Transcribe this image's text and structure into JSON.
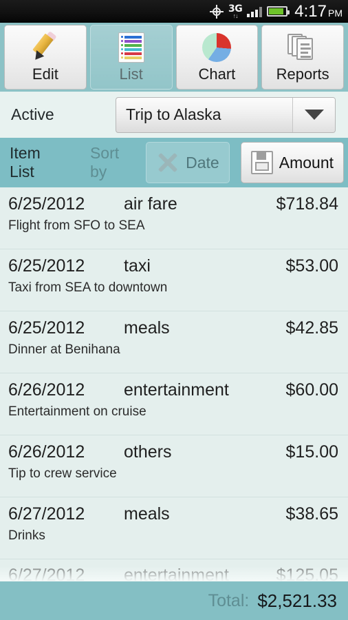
{
  "statusbar": {
    "gps_icon": "gps-crosshair-icon",
    "network_label": "3G",
    "network_arrows": "↑↓",
    "signal_icon": "signal-bars-icon",
    "battery_icon": "battery-icon",
    "time": "4:17",
    "ampm": "PM"
  },
  "toolbar": {
    "buttons": [
      {
        "label": "Edit",
        "icon": "pencil-icon",
        "selected": false
      },
      {
        "label": "List",
        "icon": "list-icon",
        "selected": true
      },
      {
        "label": "Chart",
        "icon": "pie-chart-icon",
        "selected": false
      },
      {
        "label": "Reports",
        "icon": "documents-icon",
        "selected": false
      }
    ]
  },
  "active": {
    "label": "Active",
    "selected_trip": "Trip to Alaska",
    "dropdown_icon": "chevron-down-icon"
  },
  "sort": {
    "title": "Item List",
    "sort_by_label": "Sort by",
    "date_button": "Date",
    "date_icon": "x-cross-icon",
    "amount_button": "Amount",
    "amount_icon": "floppy-save-icon"
  },
  "items": [
    {
      "date": "6/25/2012",
      "category": "air fare",
      "amount": "$718.84",
      "description": "Flight from SFO to SEA"
    },
    {
      "date": "6/25/2012",
      "category": "taxi",
      "amount": "$53.00",
      "description": "Taxi from SEA to downtown"
    },
    {
      "date": "6/25/2012",
      "category": "meals",
      "amount": "$42.85",
      "description": "Dinner at Benihana"
    },
    {
      "date": "6/26/2012",
      "category": "entertainment",
      "amount": "$60.00",
      "description": "Entertainment on cruise"
    },
    {
      "date": "6/26/2012",
      "category": "others",
      "amount": "$15.00",
      "description": "Tip to crew service"
    },
    {
      "date": "6/27/2012",
      "category": "meals",
      "amount": "$38.65",
      "description": "Drinks"
    },
    {
      "date": "6/27/2012",
      "category": "entertainment",
      "amount": "$125.05",
      "description": ""
    }
  ],
  "total": {
    "label": "Total:",
    "value": "$2,521.33"
  },
  "colors": {
    "teal_bar": "#7dbdc4",
    "toolbar_teal": "#8cc2c6",
    "list_bg": "#e4efed",
    "active_bg": "#e8f2f0",
    "total_bar": "#84bfc4",
    "battery_green": "#6ec32a"
  }
}
